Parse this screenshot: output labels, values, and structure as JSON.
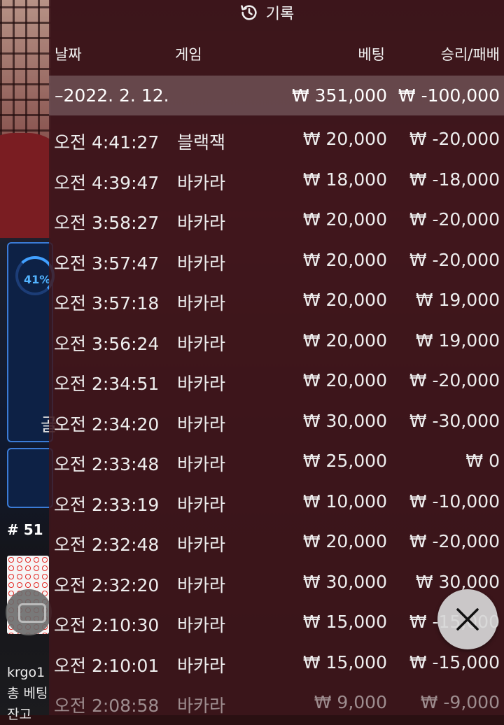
{
  "header": {
    "title": "기록",
    "icon": "history-icon"
  },
  "columns": {
    "date": "날짜",
    "game": "게임",
    "bet": "베팅",
    "result": "승리/패배"
  },
  "date_row": {
    "date": "–2022. 2. 12.",
    "bet": "₩ 351,000",
    "result": "₩ -100,000"
  },
  "rows": [
    {
      "time": "오전 4:41:27",
      "game": "블랙잭",
      "bet": "₩ 20,000",
      "result": "₩ -20,000"
    },
    {
      "time": "오전 4:39:47",
      "game": "바카라",
      "bet": "₩ 18,000",
      "result": "₩ -18,000"
    },
    {
      "time": "오전 3:58:27",
      "game": "바카라",
      "bet": "₩ 20,000",
      "result": "₩ -20,000"
    },
    {
      "time": "오전 3:57:47",
      "game": "바카라",
      "bet": "₩ 20,000",
      "result": "₩ -20,000"
    },
    {
      "time": "오전 3:57:18",
      "game": "바카라",
      "bet": "₩ 20,000",
      "result": "₩ 19,000"
    },
    {
      "time": "오전 3:56:24",
      "game": "바카라",
      "bet": "₩ 20,000",
      "result": "₩ 19,000"
    },
    {
      "time": "오전 2:34:51",
      "game": "바카라",
      "bet": "₩ 20,000",
      "result": "₩ -20,000"
    },
    {
      "time": "오전 2:34:20",
      "game": "바카라",
      "bet": "₩ 30,000",
      "result": "₩ -30,000"
    },
    {
      "time": "오전 2:33:48",
      "game": "바카라",
      "bet": "₩ 25,000",
      "result": "₩ 0"
    },
    {
      "time": "오전 2:33:19",
      "game": "바카라",
      "bet": "₩ 10,000",
      "result": "₩ -10,000"
    },
    {
      "time": "오전 2:32:48",
      "game": "바카라",
      "bet": "₩ 20,000",
      "result": "₩ -20,000"
    },
    {
      "time": "오전 2:32:20",
      "game": "바카라",
      "bet": "₩ 30,000",
      "result": "₩ 30,000"
    },
    {
      "time": "오전 2:10:30",
      "game": "바카라",
      "bet": "₩ 15,000",
      "result": "₩ -15,000"
    },
    {
      "time": "오전 2:10:01",
      "game": "바카라",
      "bet": "₩ 15,000",
      "result": "₩ -15,000"
    },
    {
      "time": "오전 2:08:58",
      "game": "바카라",
      "bet": "₩ 9,000",
      "result": "₩ -9,000"
    }
  ],
  "background": {
    "percent": "41%",
    "panel_text": "골",
    "round": "# 51",
    "user": "krgo1",
    "total_bet": "총 베팅",
    "balance": "잔고"
  },
  "close_button": {
    "icon": "close-icon"
  }
}
